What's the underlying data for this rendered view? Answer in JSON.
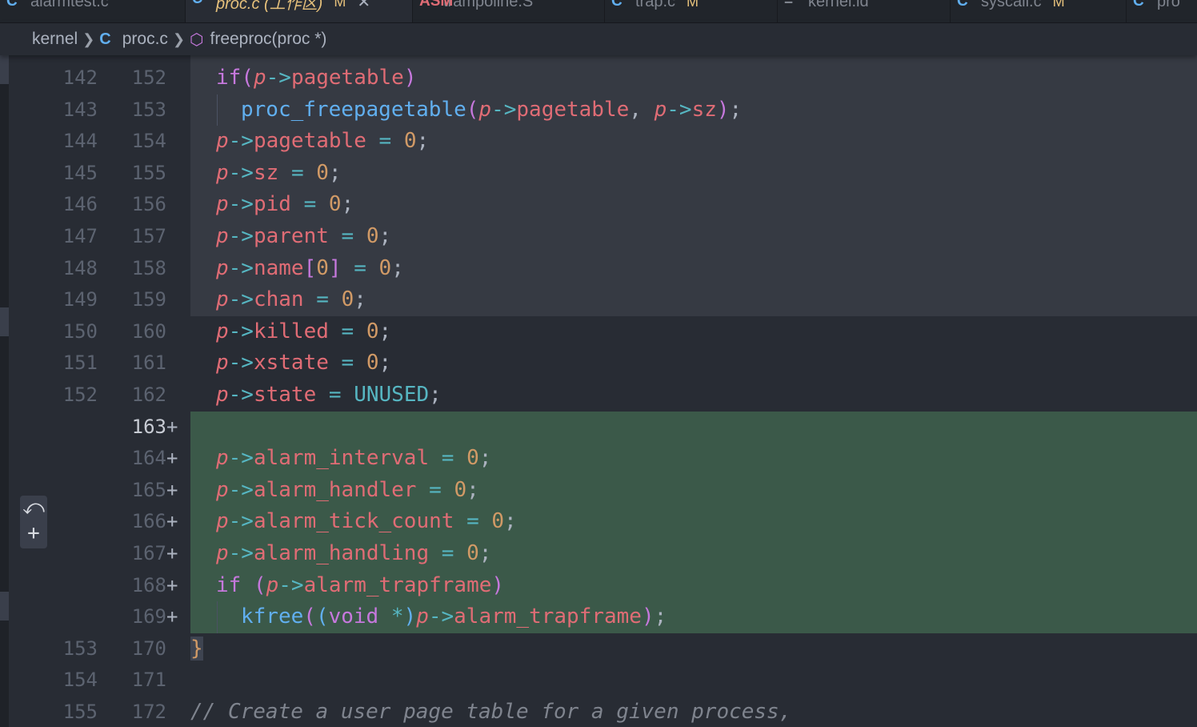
{
  "tabs": [
    {
      "label": "alarmtest.c",
      "icon": "C",
      "modified": "",
      "active": false
    },
    {
      "label": "proc.c (工作区)",
      "icon": "C",
      "modified": "M",
      "active": true
    },
    {
      "label": "trampoline.S",
      "icon": "asm",
      "modified": "",
      "active": false
    },
    {
      "label": "trap.c",
      "icon": "C",
      "modified": "M",
      "active": false
    },
    {
      "label": "kernel.ld",
      "icon": "=",
      "modified": "",
      "active": false
    },
    {
      "label": "syscall.c",
      "icon": "C",
      "modified": "M",
      "active": false
    },
    {
      "label": "pro",
      "icon": "C",
      "modified": "",
      "active": false
    }
  ],
  "breadcrumb": {
    "folder": "kernel",
    "file_icon": "C",
    "file": "proc.c",
    "symbol": "freeproc(proc *)"
  },
  "hover_actions": {
    "revert_icon": "⤺",
    "stage_icon": "+"
  },
  "lines": [
    {
      "old": "142",
      "new": "152",
      "text": "if(p->pagetable)"
    },
    {
      "old": "143",
      "new": "153",
      "text": "proc_freepagetable(p->pagetable, p->sz);"
    },
    {
      "old": "144",
      "new": "154",
      "text": "p->pagetable = 0;"
    },
    {
      "old": "145",
      "new": "155",
      "text": "p->sz = 0;"
    },
    {
      "old": "146",
      "new": "156",
      "text": "p->pid = 0;"
    },
    {
      "old": "147",
      "new": "157",
      "text": "p->parent = 0;"
    },
    {
      "old": "148",
      "new": "158",
      "text": "p->name[0] = 0;"
    },
    {
      "old": "149",
      "new": "159",
      "text": "p->chan = 0;"
    },
    {
      "old": "150",
      "new": "160",
      "text": "p->killed = 0;"
    },
    {
      "old": "151",
      "new": "161",
      "text": "p->xstate = 0;"
    },
    {
      "old": "152",
      "new": "162",
      "text": "p->state = UNUSED;"
    },
    {
      "old": "",
      "new": "163",
      "text": ""
    },
    {
      "old": "",
      "new": "164",
      "text": "p->alarm_interval = 0;"
    },
    {
      "old": "",
      "new": "165",
      "text": "p->alarm_handler = 0;"
    },
    {
      "old": "",
      "new": "166",
      "text": "p->alarm_tick_count = 0;"
    },
    {
      "old": "",
      "new": "167",
      "text": "p->alarm_handling = 0;"
    },
    {
      "old": "",
      "new": "168",
      "text": "if (p->alarm_trapframe)"
    },
    {
      "old": "",
      "new": "169",
      "text": "kfree((void *)p->alarm_trapframe);"
    },
    {
      "old": "153",
      "new": "170",
      "text": "}"
    },
    {
      "old": "154",
      "new": "171",
      "text": ""
    },
    {
      "old": "155",
      "new": "172",
      "text": "// Create a user page table for a given process,"
    }
  ],
  "colors": {
    "background": "#282c34",
    "added_line": "#3b5949",
    "unchanged_context": "#363a43",
    "keyword": "#c678dd",
    "variable": "#e06c75",
    "number": "#d19a66",
    "function": "#61afef",
    "operator": "#56b6c2",
    "comment": "#7f848e"
  }
}
